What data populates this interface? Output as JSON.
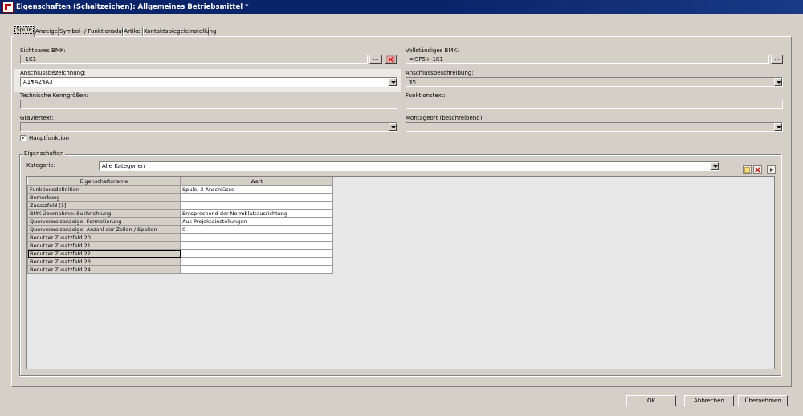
{
  "window": {
    "title": "Eigenschaften (Schaltzeichen): Allgemeines Betriebsmittel *"
  },
  "tabs": [
    {
      "label": "Spule"
    },
    {
      "label": "Anzeige"
    },
    {
      "label": "Symbol- / Funktionsdaten"
    },
    {
      "label": "Artikel"
    },
    {
      "label": "Kontaktspiegeleinstellung"
    }
  ],
  "form": {
    "sichtbares_bmk": {
      "label": "Sichtbares BMK:",
      "value": "-1K1"
    },
    "vollstaendiges_bmk": {
      "label": "Vollständiges BMK:",
      "value": "=ISP5+-1K1"
    },
    "anschlussbezeichnung": {
      "label": "Anschlussbezeichnung:",
      "value": "A1¶A2¶A3"
    },
    "anschlussbeschreibung": {
      "label": "Anschlussbeschreibung:",
      "value": "¶¶"
    },
    "technische_kenngroessen": {
      "label": "Technische Kenngrößen:",
      "value": ""
    },
    "funktionstext": {
      "label": "Funktionstext:",
      "value": ""
    },
    "graviertext": {
      "label": "Graviertext:",
      "value": ""
    },
    "montageort": {
      "label": "Montageort (beschreibend):",
      "value": ""
    },
    "hauptfunktion": {
      "label": "Hauptfunktion",
      "checked": true,
      "mark": "✔"
    },
    "browse_label": "..."
  },
  "properties": {
    "group_label": "Eigenschaften",
    "kategorie_label": "Kategorie:",
    "kategorie_value": "Alle Kategorien",
    "columns": [
      "Eigenschaftsname",
      "Wert"
    ],
    "rows": [
      {
        "name": "Funktionsdefinition",
        "value": "Spule, 3 Anschlüsse"
      },
      {
        "name": "Bemerkung",
        "value": ""
      },
      {
        "name": "Zusatzfeld [1]",
        "value": ""
      },
      {
        "name": "BMK-Übernahme: Suchrichtung",
        "value": "Entsprechend der Normblattausrichtung"
      },
      {
        "name": "Querverweisanzeige: Formatierung",
        "value": "Aus Projekteinstellungen"
      },
      {
        "name": "Querverweisanzeige: Anzahl der Zeilen / Spalten",
        "value": "0"
      },
      {
        "name": "Benutzer Zusatzfeld 20",
        "value": ""
      },
      {
        "name": "Benutzer Zusatzfeld 21",
        "value": ""
      },
      {
        "name": "Benutzer Zusatzfeld 22",
        "value": ""
      },
      {
        "name": "Benutzer Zusatzfeld 23",
        "value": ""
      },
      {
        "name": "Benutzer Zusatzfeld 24",
        "value": ""
      }
    ],
    "selected_row": 8
  },
  "buttons": {
    "ok": "OK",
    "cancel": "Abbrechen",
    "apply": "Übernehmen"
  },
  "colors": {
    "titlebar": "#0a246a",
    "dialog": "#d4d0c8",
    "delete_icon": "#d02020"
  },
  "icons": {
    "app": "app-icon",
    "delete": "delete-icon",
    "new": "new-icon",
    "more": "more-icon"
  }
}
